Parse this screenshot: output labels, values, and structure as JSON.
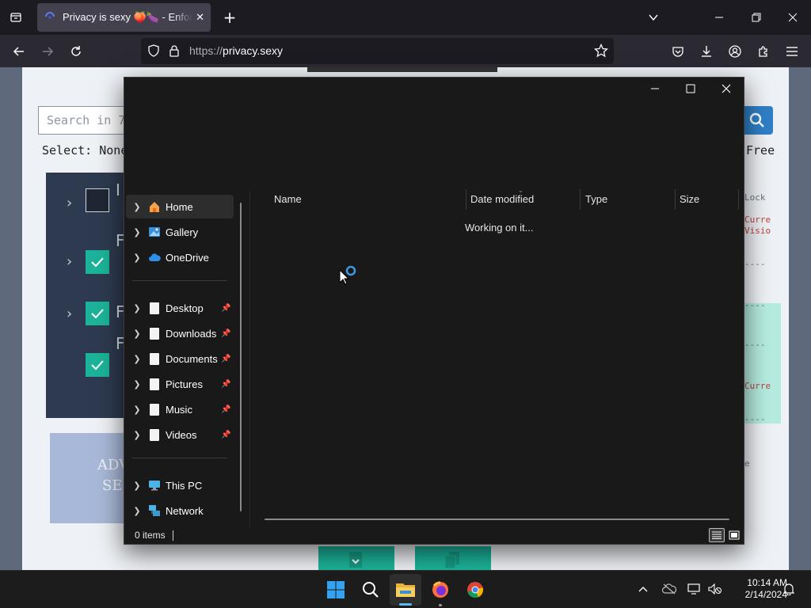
{
  "browser": {
    "tab_title": "Privacy is sexy 🍑🍆 - Enforce privacy & security best-practices on Windows, macOS and Linux",
    "url_scheme": "https://",
    "url_host": "privacy.sexy"
  },
  "webpage": {
    "search_placeholder": "Search in 7",
    "select_label": "Select: None",
    "right_free": "Free",
    "script_items": [
      {
        "letter": "I",
        "checked": false
      },
      {
        "letter": "F",
        "checked": true
      },
      {
        "letter": "F",
        "checked": true
      },
      {
        "letter": "F",
        "checked": true
      }
    ],
    "advanced_label_1": "ADV",
    "advanced_label_2": "SE",
    "code_fragments": [
      "Lock",
      "Curre",
      "Visio",
      "----",
      "----",
      "----",
      "Curre",
      "----",
      "e"
    ]
  },
  "explorer": {
    "nav_items": [
      {
        "label": "Home",
        "icon": "home-icon",
        "pinned": false
      },
      {
        "label": "Gallery",
        "icon": "gallery-icon",
        "pinned": false
      },
      {
        "label": "OneDrive",
        "icon": "cloud-icon",
        "pinned": false
      },
      {
        "label": "Desktop",
        "icon": "file-icon",
        "pinned": true
      },
      {
        "label": "Downloads",
        "icon": "file-icon",
        "pinned": true
      },
      {
        "label": "Documents",
        "icon": "file-icon",
        "pinned": true
      },
      {
        "label": "Pictures",
        "icon": "file-icon",
        "pinned": true
      },
      {
        "label": "Music",
        "icon": "file-icon",
        "pinned": true
      },
      {
        "label": "Videos",
        "icon": "file-icon",
        "pinned": true
      },
      {
        "label": "This PC",
        "icon": "computer-icon",
        "pinned": false
      },
      {
        "label": "Network",
        "icon": "network-icon",
        "pinned": false
      }
    ],
    "columns": [
      "Name",
      "Date modified",
      "Type",
      "Size"
    ],
    "working_text": "Working on it...",
    "status_items": "0 items"
  },
  "taskbar": {
    "time": "10:14 AM",
    "date": "2/14/2024"
  },
  "colors": {
    "accent_blue": "#0078d4",
    "page_teal": "#1cb39a",
    "page_navy": "#2d3a4f"
  }
}
